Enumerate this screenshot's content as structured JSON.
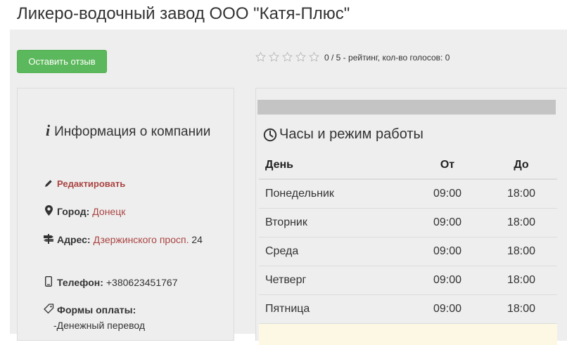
{
  "page": {
    "title": "Ликеро-водочный завод ООО \"Катя-Плюс\""
  },
  "toolbar": {
    "review_button": "Оставить отзыв",
    "rating_text": "0 / 5 - рейтинг, кол-во голосов: 0",
    "rating_value": 0,
    "rating_max": 5
  },
  "info": {
    "title": "Информация о компании",
    "edit_label": "Редактировать",
    "city_label": "Город:",
    "city_value": "Донецк",
    "address_label": "Адрес:",
    "address_link": "Дзержинского просп.",
    "address_number": "24",
    "phone_label": "Телефон:",
    "phone_value": "+380623451767",
    "payment_label": "Формы оплаты:",
    "payment_value": "-Денежный перевод"
  },
  "hours": {
    "title": "Часы и режим работы",
    "columns": [
      "День",
      "От",
      "До"
    ],
    "rows": [
      [
        "Понедельник",
        "09:00",
        "18:00"
      ],
      [
        "Вторник",
        "09:00",
        "18:00"
      ],
      [
        "Среда",
        "09:00",
        "18:00"
      ],
      [
        "Четверг",
        "09:00",
        "18:00"
      ],
      [
        "Пятница",
        "09:00",
        "18:00"
      ]
    ]
  },
  "icons": {
    "info": "info-icon",
    "edit": "pencil-icon",
    "city": "map-marker-icon",
    "address": "road-sign-icon",
    "phone": "phone-icon",
    "payment": "tag-icon",
    "clock": "clock-icon",
    "star": "star-outline-icon"
  },
  "colors": {
    "button_green": "#5cb85c",
    "link_red": "#a94442",
    "panel_gray": "#eeeeee"
  }
}
